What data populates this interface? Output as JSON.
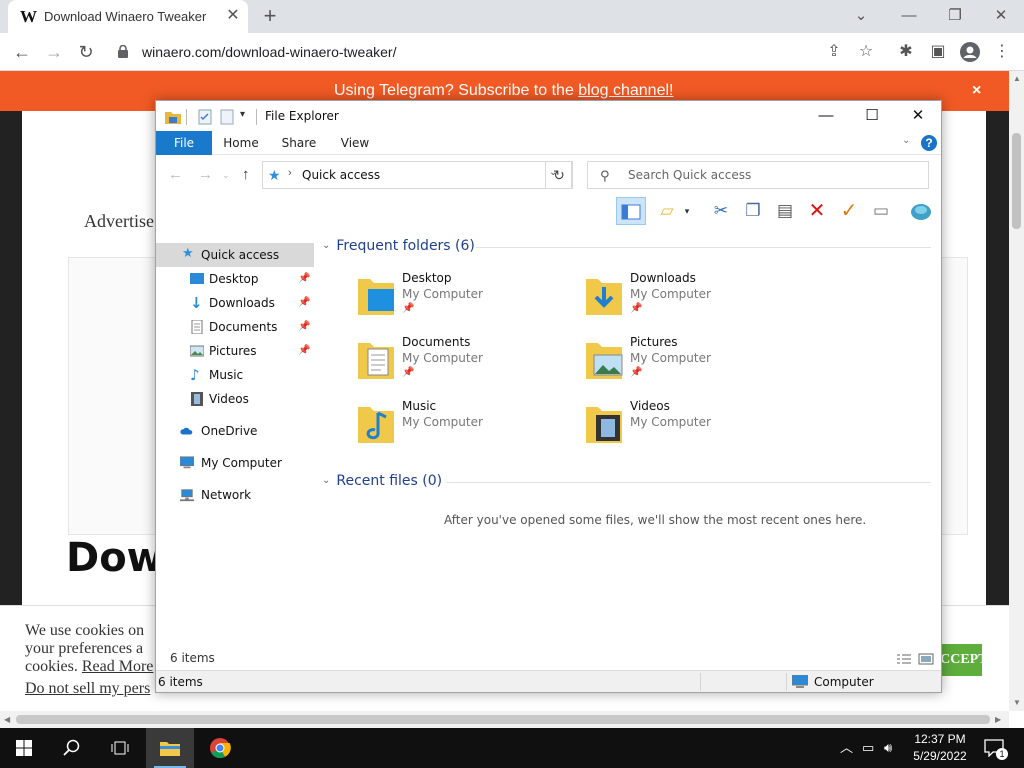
{
  "browser": {
    "tab": {
      "favicon_letter": "W",
      "title": "Download Winaero Tweaker",
      "close": "✕"
    },
    "new_tab": "+",
    "window_controls": {
      "tabsearch": "⌄",
      "minimize": "—",
      "restore": "❐",
      "close": "✕"
    },
    "url": "winaero.com/download-winaero-tweaker/"
  },
  "webpage": {
    "banner": {
      "prefix": "Using Telegram? Subscribe to the ",
      "link": "blog channel!",
      "close": "×"
    },
    "advert_label": "Advertise",
    "heading": "Dow",
    "cookie": {
      "line1": "We use cookies on",
      "line2": "your preferences a",
      "line3_prefix": "cookies. ",
      "line3_link": "Read More",
      "do_not_sell": "Do not sell my pers",
      "accept": "ACCEPT"
    }
  },
  "explorer": {
    "title": "File Explorer",
    "window_controls": {
      "minimize": "—",
      "maximize": "☐",
      "close": "✕"
    },
    "ribbon_tabs": [
      "File",
      "Home",
      "Share",
      "View"
    ],
    "help": "?",
    "address": {
      "location": "Quick access"
    },
    "search_placeholder": "Search Quick access",
    "nav": [
      {
        "label": "Quick access",
        "pinned": false,
        "selected": true
      },
      {
        "label": "Desktop",
        "pinned": true
      },
      {
        "label": "Downloads",
        "pinned": true
      },
      {
        "label": "Documents",
        "pinned": true
      },
      {
        "label": "Pictures",
        "pinned": true
      },
      {
        "label": "Music",
        "pinned": false
      },
      {
        "label": "Videos",
        "pinned": false
      },
      {
        "label": "OneDrive",
        "pinned": false
      },
      {
        "label": "My Computer",
        "pinned": false
      },
      {
        "label": "Network",
        "pinned": false
      }
    ],
    "frequent_header": "Frequent folders (6)",
    "folders": [
      {
        "name": "Desktop",
        "location": "My Computer",
        "pinned": true
      },
      {
        "name": "Downloads",
        "location": "My Computer",
        "pinned": true
      },
      {
        "name": "Documents",
        "location": "My Computer",
        "pinned": true
      },
      {
        "name": "Pictures",
        "location": "My Computer",
        "pinned": true
      },
      {
        "name": "Music",
        "location": "My Computer",
        "pinned": false
      },
      {
        "name": "Videos",
        "location": "My Computer",
        "pinned": false
      }
    ],
    "recent_header": "Recent files (0)",
    "recent_empty": "After you've opened some files, we'll show the most recent ones here.",
    "item_count_main": "6 items",
    "status_left": "6 items",
    "status_right": "Computer"
  },
  "taskbar": {
    "time": "12:37 PM",
    "date": "5/29/2022",
    "notification_count": "1"
  },
  "colors": {
    "banner": "#f15a24",
    "explorer_file_tab": "#1979ca",
    "accept_button": "#5fad3d",
    "taskbar": "#101010",
    "group_header": "#1f3f8f"
  }
}
